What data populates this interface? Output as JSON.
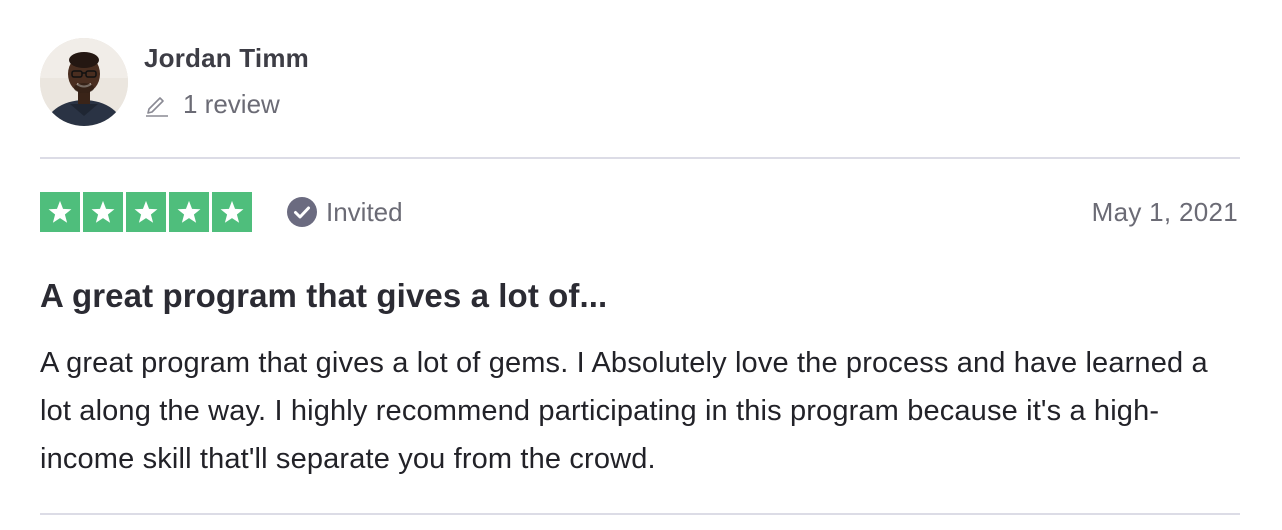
{
  "reviewer": {
    "name": "Jordan Timm",
    "review_count": "1 review",
    "avatar_icon": "person-avatar",
    "count_icon": "pencil-icon"
  },
  "rating": {
    "stars": 5,
    "max_stars": 5,
    "star_color": "#4fbe7c",
    "status_label": "Invited",
    "status_icon": "check-circle-icon",
    "date": "May 1, 2021"
  },
  "review": {
    "title": "A great program that gives a lot of...",
    "body": "A great program that gives a lot of gems. I Absolutely love the process and have learned a lot along the way. I highly recommend participating in this program because it's a high-income skill that'll separate you from the crowd."
  },
  "colors": {
    "text_primary": "#3d3d45",
    "text_secondary": "#6b6b75",
    "divider": "#dcdce6",
    "check_badge": "#6b6b80"
  }
}
